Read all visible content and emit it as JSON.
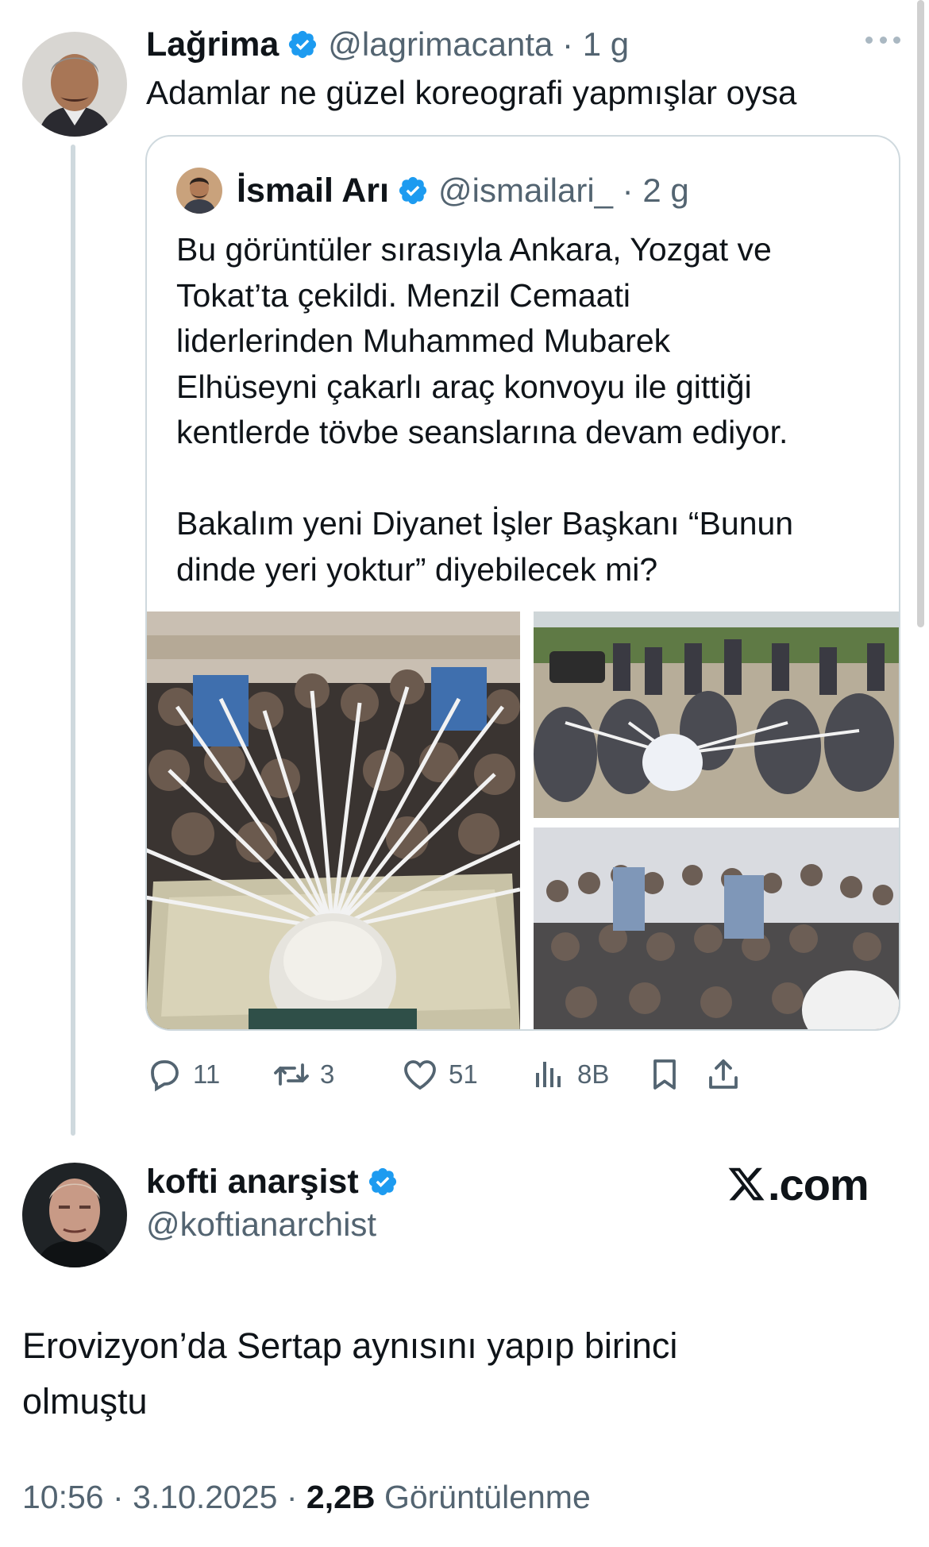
{
  "tweet1": {
    "author_name": "Lağrima",
    "handle": "@lagrimacanta",
    "time": "1 g",
    "text": "Adamlar ne güzel koreografi yapmışlar oysa"
  },
  "quote": {
    "author_name": "İsmail Arı",
    "handle": "@ismailari_",
    "time": "2 g",
    "lines": [
      "Bu görüntüler sırasıyla Ankara, Yozgat ve",
      "Tokat’ta çekildi. Menzil Cemaati",
      "liderlerinden Muhammed Mubarek",
      "Elhüseyni çakarlı araç konvoyu ile gittiği",
      "kentlerde tövbe seanslarına devam ediyor."
    ],
    "lines2": [
      "Bakalım yeni Diyanet İşler Başkanı “Bunun",
      "dinde yeri yoktur” diyebilecek mi?"
    ]
  },
  "actions": {
    "replies": "11",
    "reposts": "3",
    "likes": "51",
    "views": "8B"
  },
  "tweet2": {
    "author_name": "kofti anarşist",
    "handle": "@koftianarchist",
    "brand": ".com",
    "lines": [
      "Erovizyon’da Sertap aynısını yapıp birinci",
      "olmuştu"
    ],
    "time": "10:56",
    "date": "3.10.2025",
    "views": "2,2B",
    "views_label": "Görüntülenme"
  },
  "icons": {
    "verified": "verified-badge-icon",
    "more": "more-icon",
    "reply": "reply-icon",
    "repost": "repost-icon",
    "like": "like-icon",
    "views": "views-icon",
    "bookmark": "bookmark-icon",
    "share": "share-icon",
    "brand": "x-logo-icon"
  },
  "colors": {
    "verified": "#1d9bf0",
    "text": "#0f1419",
    "secondary": "#536471",
    "border": "#cfd9de"
  }
}
